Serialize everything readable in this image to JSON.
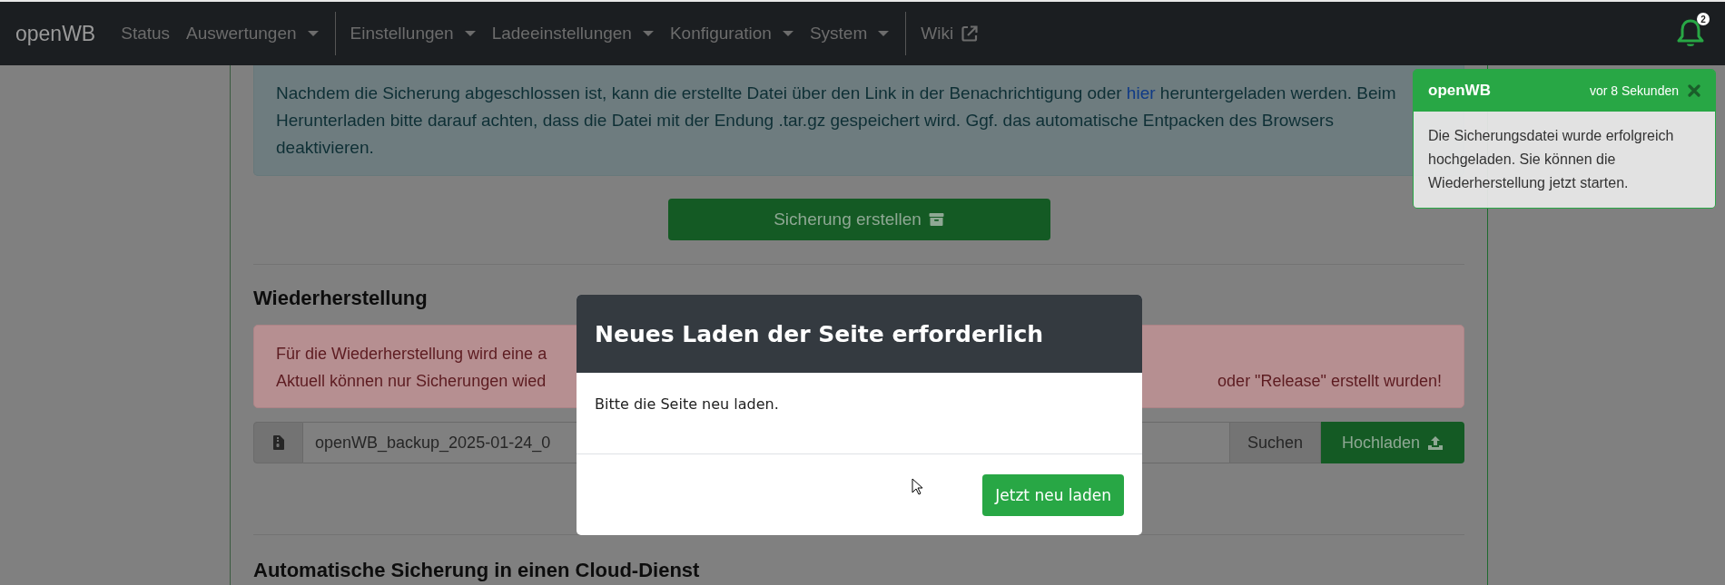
{
  "navbar": {
    "brand": "openWB",
    "items": [
      {
        "kind": "link",
        "label": "Status"
      },
      {
        "kind": "dropdown",
        "label": "Auswertungen"
      },
      {
        "kind": "separator"
      },
      {
        "kind": "dropdown",
        "label": "Einstellungen"
      },
      {
        "kind": "dropdown",
        "label": "Ladeeinstellungen"
      },
      {
        "kind": "dropdown",
        "label": "Konfiguration"
      },
      {
        "kind": "dropdown",
        "label": "System"
      },
      {
        "kind": "separator"
      },
      {
        "kind": "external",
        "label": "Wiki"
      }
    ],
    "notifications": {
      "count": "2"
    }
  },
  "backup": {
    "info": {
      "before": "Nachdem die Sicherung abgeschlossen ist, kann die erstellte Datei über den Link in der Benachrichtigung oder ",
      "link": "hier",
      "after": " heruntergeladen werden. Beim Herunterladen bitte darauf achten, dass die Datei mit der Endung .tar.gz gespeichert wird. Ggf. das automatische Entpacken des Browsers deaktivieren."
    },
    "button": "Sicherung erstellen"
  },
  "restore": {
    "heading": "Wiederherstellung",
    "warning_left": [
      "Für die Wiederherstellung wird eine a",
      "Aktuell können nur Sicherungen wied"
    ],
    "warning_right": [
      "oder \"Release\" erstellt wurden!"
    ],
    "file_value": "openWB_backup_2025-01-24_0",
    "browse": "Suchen",
    "upload": "Hochladen"
  },
  "cloud": {
    "heading": "Automatische Sicherung in einen Cloud-Dienst"
  },
  "modal": {
    "title": "Neues Laden der Seite erforderlich",
    "body": "Bitte die Seite neu laden.",
    "button": "Jetzt neu laden"
  },
  "toast": {
    "title": "openWB",
    "time": "vor 8 Sekunden",
    "body": "Die Sicherungsdatei wurde erfolgreich hochgeladen. Sie können die Wiederherstellung jetzt starten."
  }
}
